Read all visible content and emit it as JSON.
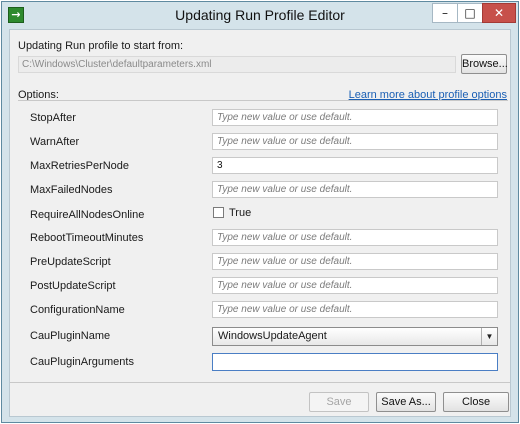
{
  "window": {
    "title": "Updating Run Profile Editor",
    "app_icon": "arrow-right-icon",
    "controls": {
      "minimize": "–",
      "maximize": "□",
      "close": "✕"
    }
  },
  "profile": {
    "start_label": "Updating Run profile to start from:",
    "path": "C:\\Windows\\Cluster\\defaultparameters.xml",
    "browse_label": "Browse..."
  },
  "options": {
    "label": "Options:",
    "learn_more": "Learn more about profile options",
    "placeholder": "Type new value or use default.",
    "rows": [
      {
        "name": "StopAfter",
        "kind": "text",
        "value": ""
      },
      {
        "name": "WarnAfter",
        "kind": "text",
        "value": ""
      },
      {
        "name": "MaxRetriesPerNode",
        "kind": "text",
        "value": "3"
      },
      {
        "name": "MaxFailedNodes",
        "kind": "text",
        "value": ""
      },
      {
        "name": "RequireAllNodesOnline",
        "kind": "checkbox",
        "value": "True",
        "checked": false
      },
      {
        "name": "RebootTimeoutMinutes",
        "kind": "text",
        "value": ""
      },
      {
        "name": "PreUpdateScript",
        "kind": "text",
        "value": ""
      },
      {
        "name": "PostUpdateScript",
        "kind": "text",
        "value": ""
      },
      {
        "name": "ConfigurationName",
        "kind": "text",
        "value": ""
      },
      {
        "name": "CauPluginName",
        "kind": "select",
        "value": "WindowsUpdateAgent"
      },
      {
        "name": "CauPluginArguments",
        "kind": "args",
        "value": ""
      }
    ]
  },
  "footer": {
    "save_label": "Save",
    "save_as_label": "Save As...",
    "close_label": "Close"
  },
  "colors": {
    "frame": "#d4e3ea",
    "close_button": "#c7504a",
    "link": "#1a5fb4"
  }
}
